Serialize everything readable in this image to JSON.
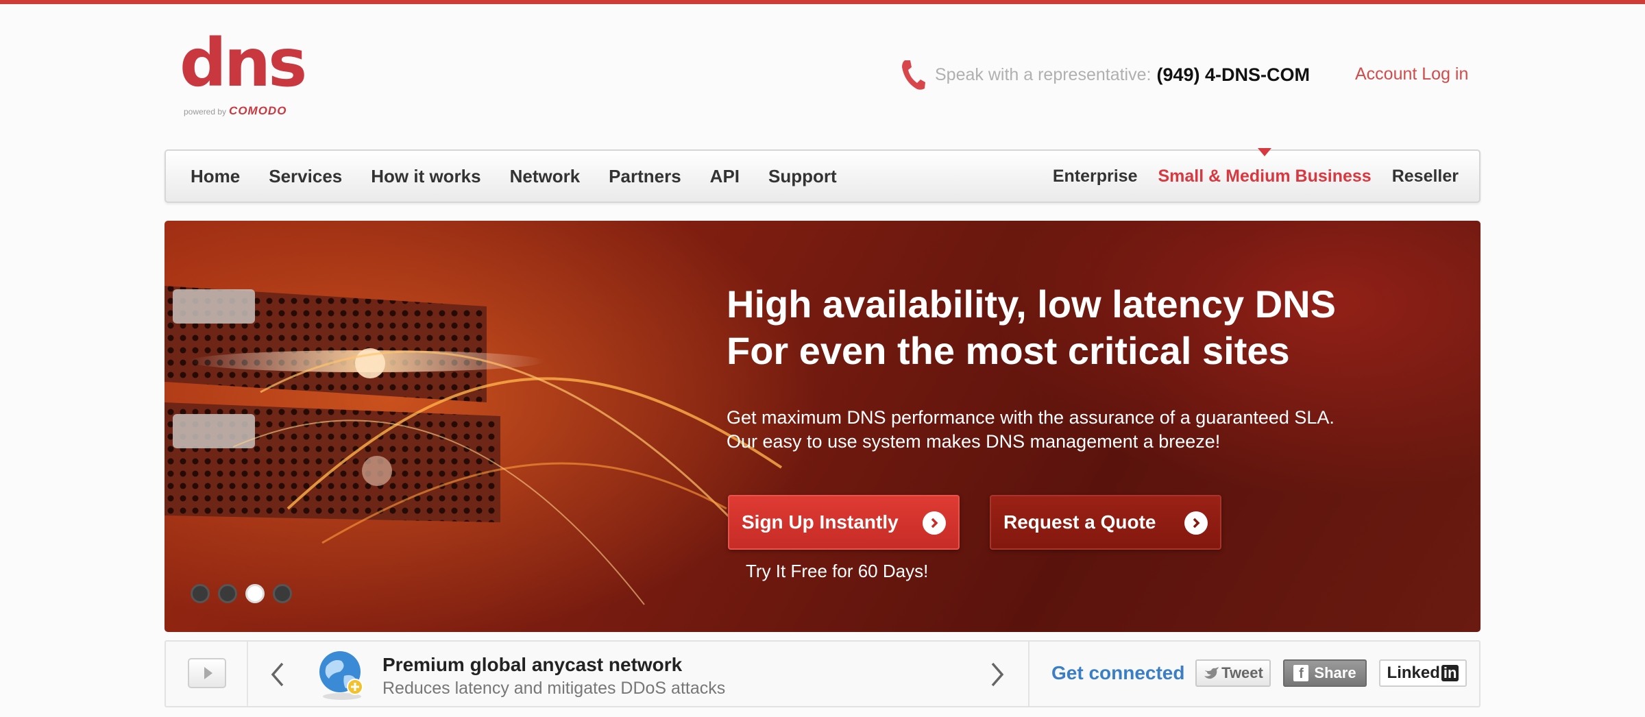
{
  "brand": {
    "logo_text": "dns",
    "powered_by": "powered by",
    "powered_brand": "COMODO",
    "accent_color": "#cf3b35"
  },
  "header": {
    "speak_label": "Speak with a representative:",
    "phone_number": "(949) 4-DNS-COM",
    "account_link": "Account Log in",
    "phone_icon": "phone-icon"
  },
  "nav": {
    "left_items": [
      {
        "label": "Home"
      },
      {
        "label": "Services"
      },
      {
        "label": "How it works"
      },
      {
        "label": "Network"
      },
      {
        "label": "Partners"
      },
      {
        "label": "API"
      },
      {
        "label": "Support"
      }
    ],
    "right_items": [
      {
        "label": "Enterprise",
        "active": false
      },
      {
        "label": "Small & Medium Business",
        "active": true
      },
      {
        "label": "Reseller",
        "active": false
      }
    ],
    "active_color": "#d8383f"
  },
  "hero": {
    "title_line1": "High availability, low latency DNS",
    "title_line2": "For even the most critical sites",
    "desc_line1": "Get maximum DNS performance with the assurance of a guaranteed SLA.",
    "desc_line2": "Our easy to use system makes DNS management a breeze!",
    "signup_label": "Sign Up Instantly",
    "quote_label": "Request a Quote",
    "try_free": "Try It Free for 60 Days!",
    "slide_count": 4,
    "active_slide": 3
  },
  "feature": {
    "title": "Premium global anycast network",
    "subtitle": "Reduces latency and mitigates DDoS attacks",
    "icon": "globe-icon"
  },
  "social": {
    "heading": "Get connected",
    "tweet_label": "Tweet",
    "share_label": "Share",
    "linkedin_label": "Linked",
    "linkedin_in": "in"
  }
}
